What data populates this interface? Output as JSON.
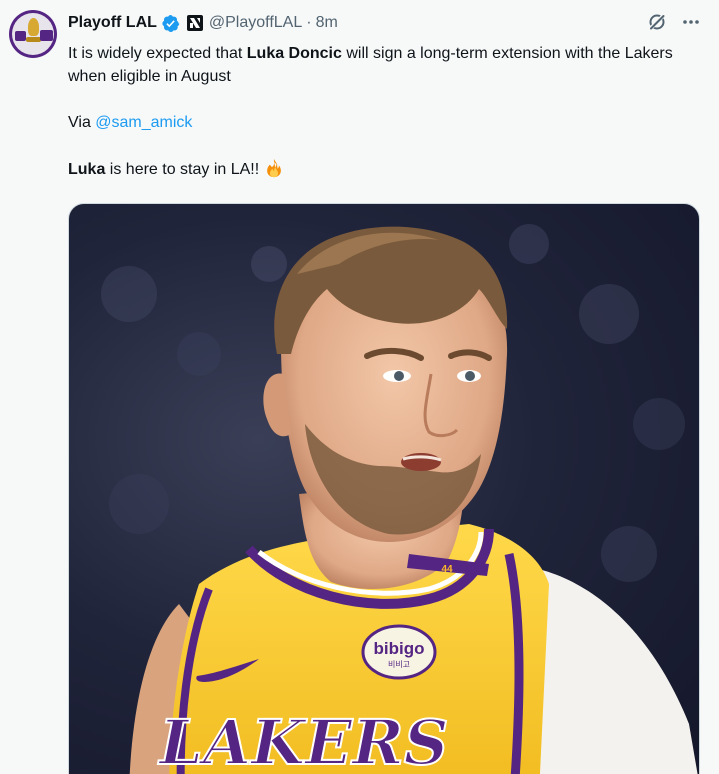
{
  "author": {
    "name": "Playoff LAL",
    "handle": "@PlayoffLAL",
    "separator": "·",
    "time": "8m"
  },
  "tweet": {
    "line1_pre": "It is widely expected that ",
    "line1_bold": "Luka Doncic",
    "line1_post": " will sign a long-term extension with the Lakers when eligible in August",
    "via_pre": "Via ",
    "via_mention": "@sam_amick",
    "last_bold": "Luka",
    "last_post": " is here to stay in LA!!"
  },
  "media": {
    "jersey_sponsor": "bibigo",
    "jersey_sponsor_sub": "비비고",
    "jersey_number": "44",
    "jersey_team": "LAKERS"
  },
  "icons": {
    "verified": "verified-badge-icon",
    "affiliation": "affiliation-icon",
    "grok": "grok-icon",
    "more": "more-icon",
    "fire": "fire-emoji-icon"
  },
  "colors": {
    "accent": "#1d9bf0",
    "lakers_purple": "#552583",
    "lakers_gold": "#fdb927"
  }
}
